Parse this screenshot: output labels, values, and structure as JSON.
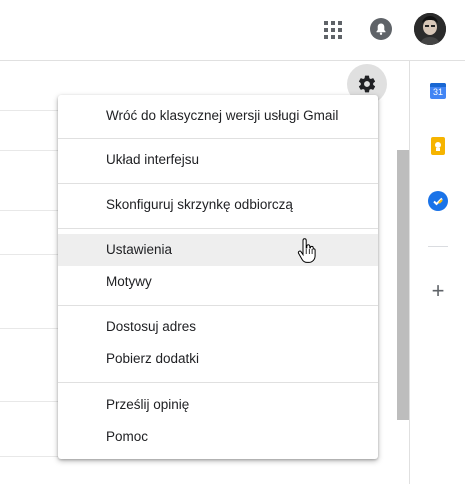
{
  "header": {
    "apps_icon": "apps-grid-icon",
    "notifications_icon": "bell-icon",
    "avatar_icon": "account-avatar"
  },
  "side_panel": {
    "calendar": {
      "icon": "calendar-icon",
      "label": "31",
      "color": "#4285f4"
    },
    "keep": {
      "icon": "keep-bulb-icon",
      "color": "#f6b400"
    },
    "tasks": {
      "icon": "tasks-check-icon",
      "color": "#1a73e8"
    },
    "add": {
      "icon": "plus-icon",
      "label": "+"
    }
  },
  "settings": {
    "icon": "gear-icon"
  },
  "menu": {
    "items": [
      {
        "label": "Wróć do klasycznej wersji usługi Gmail"
      },
      {
        "label": "Układ interfejsu"
      },
      {
        "label": "Skonfiguruj skrzynkę odbiorczą"
      },
      {
        "label": "Ustawienia",
        "highlighted": true
      },
      {
        "label": "Motywy"
      },
      {
        "label": "Dostosuj adres"
      },
      {
        "label": "Pobierz dodatki"
      },
      {
        "label": "Prześlij opinię"
      },
      {
        "label": "Pomoc"
      }
    ]
  },
  "colors": {
    "highlight": "#eeeeee",
    "divider": "#e0e0e0",
    "icon_gray": "#5f6368"
  }
}
